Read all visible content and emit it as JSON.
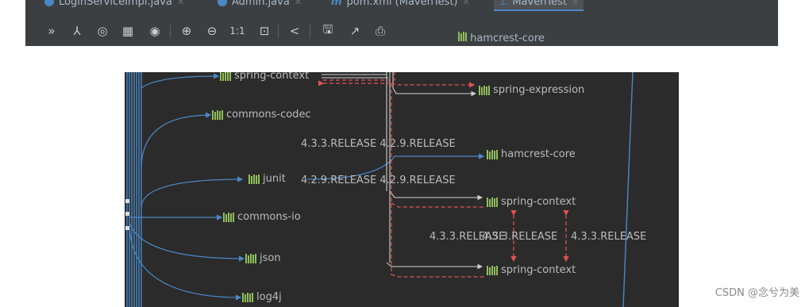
{
  "tabs": [
    {
      "label": "LoginServiceImpl.java",
      "icon": "class-icon"
    },
    {
      "label": "Admin.java",
      "icon": "class-icon"
    },
    {
      "label": "pom.xml (MavenTest)",
      "icon": "maven-icon"
    },
    {
      "label": "MavenTest",
      "icon": "diagram-icon",
      "active": true
    }
  ],
  "toolbar_glyphs": {
    "collapse": "»",
    "layout": "⅄",
    "find": "◎",
    "grid": "▦",
    "view": "◉",
    "zoom_in": "⊕",
    "zoom_out": "⊖",
    "actual_size": "1:1",
    "fit": "⊡",
    "share": "<",
    "save": "🖫",
    "export": "↗",
    "print": "⎙"
  },
  "peek_label": "hamcrest-core",
  "nodes": {
    "spring_context_top": "spring-context",
    "commons_codec": "commons-codec",
    "junit": "junit",
    "commons_io": "commons-io",
    "json": "json",
    "log4j": "log4j",
    "spring_expression": "spring-expression",
    "hamcrest_core": "hamcrest-core",
    "spring_context_mid": "spring-context",
    "spring_context_bottom": "spring-context"
  },
  "versions": {
    "row1": "4.3.3.RELEASE 4.2.9.RELEASE",
    "row2": "4.2.9.RELEASE 4.2.9.RELEASE",
    "row3a": "4.3.3.RELEASE",
    "row3b": "4.3.3.RELEASE",
    "row3c": "4.3.3.RELEASE"
  },
  "colors": {
    "editor_bg": "#2b2b2b",
    "blue_edge": "#4a88c7",
    "conflict_edge": "#e05252",
    "gray_edge": "#d0d0d0",
    "library_icon": "#8fbf5a"
  },
  "watermark": "CSDN @念兮为美"
}
